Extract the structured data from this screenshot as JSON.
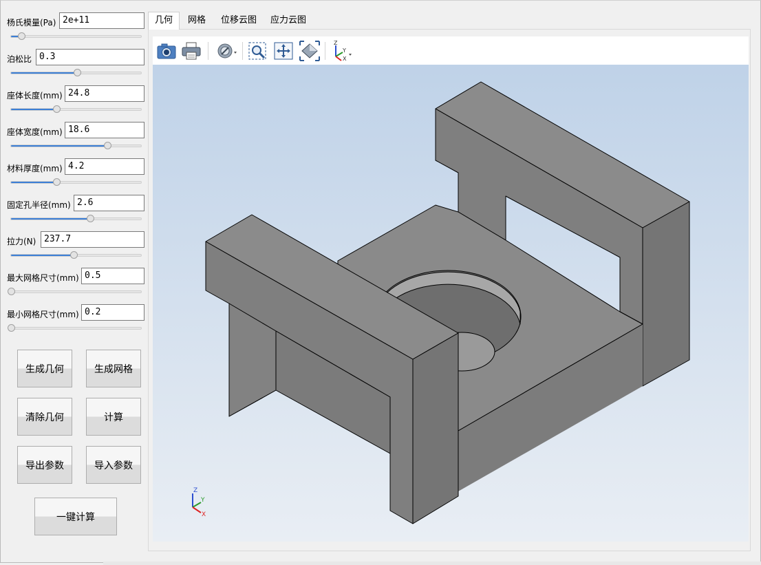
{
  "params": [
    {
      "label": "杨氏模量(Pa)",
      "value": "2e+11",
      "slider": 0.08
    },
    {
      "label": "泊松比",
      "value": "0.3",
      "slider": 0.51
    },
    {
      "label": "座体长度(mm)",
      "value": "24.8",
      "slider": 0.35
    },
    {
      "label": "座体宽度(mm)",
      "value": "18.6",
      "slider": 0.74
    },
    {
      "label": "材料厚度(mm)",
      "value": "4.2",
      "slider": 0.35
    },
    {
      "label": "固定孔半径(mm)",
      "value": "2.6",
      "slider": 0.61
    },
    {
      "label": "拉力(N)",
      "value": "237.7",
      "slider": 0.48
    },
    {
      "label": "最大网格尺寸(mm)",
      "value": "0.5",
      "slider": 0.0
    },
    {
      "label": "最小网格尺寸(mm)",
      "value": "0.2",
      "slider": 0.0
    }
  ],
  "buttons": {
    "generate_geometry": "生成几何",
    "generate_mesh": "生成网格",
    "clear_geometry": "清除几何",
    "compute": "计算",
    "export_params": "导出参数",
    "import_params": "导入参数",
    "one_click_compute": "一键计算"
  },
  "tabs": [
    "几何",
    "网格",
    "位移云图",
    "应力云图"
  ],
  "active_tab": "几何",
  "toolbar_icons": [
    "camera-icon",
    "print-icon",
    "display-mode-icon",
    "zoom-window-icon",
    "pan-icon",
    "fit-all-icon",
    "view-axes-icon"
  ],
  "triad": {
    "x": "X",
    "y": "Y",
    "z": "Z"
  },
  "colors": {
    "slider_fill": "#3c7fd6",
    "model_face": "#7f7f7f",
    "viewport_top": "#bfd2e8",
    "viewport_bottom": "#e9eef4"
  }
}
